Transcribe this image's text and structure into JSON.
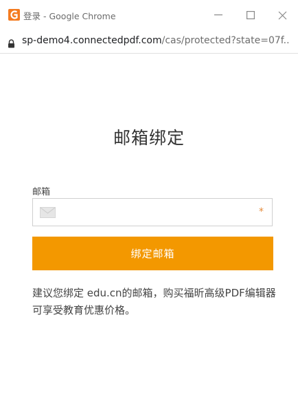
{
  "window": {
    "title": "登录 - Google Chrome",
    "minimize_glyph": "—",
    "close_glyph": "✕",
    "accent": "#f47b20"
  },
  "address": {
    "host": "sp-demo4.connectedpdf.com",
    "path": "/cas/protected?state=07f..."
  },
  "page": {
    "title": "邮箱绑定",
    "email_label": "邮箱",
    "email_value": "",
    "required_mark": "*",
    "button_label": "绑定邮箱",
    "button_color": "#f39800",
    "hint": "建议您绑定 edu.cn的邮箱，购买福昕高级PDF编辑器可享受教育优惠价格。"
  },
  "icons": {
    "app": "foxit-icon",
    "lock": "lock-icon",
    "mail": "mail-icon"
  }
}
